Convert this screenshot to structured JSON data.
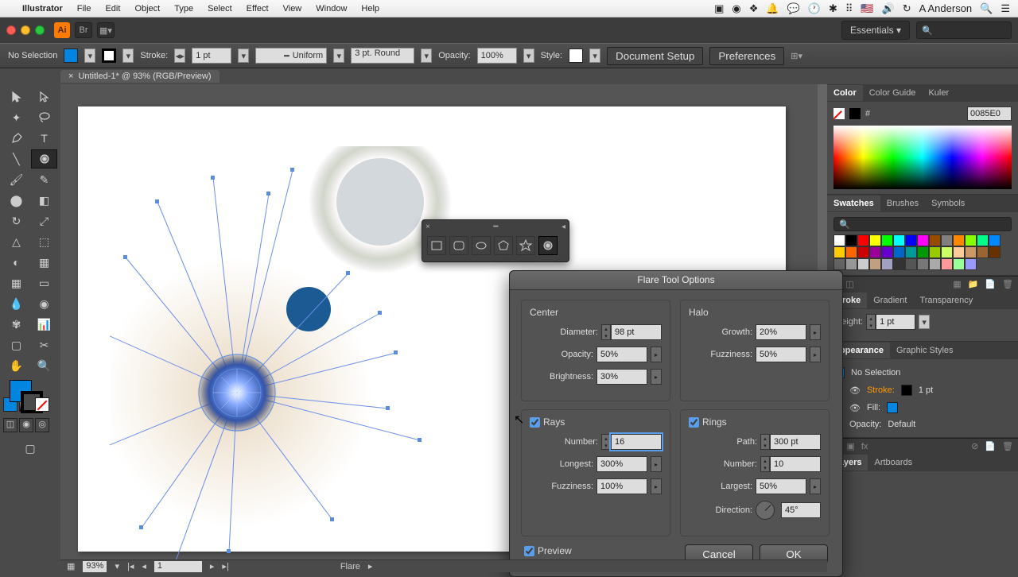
{
  "menubar": {
    "app": "Illustrator",
    "items": [
      "File",
      "Edit",
      "Object",
      "Type",
      "Select",
      "Effect",
      "View",
      "Window",
      "Help"
    ],
    "user": "A Anderson"
  },
  "titlebar": {
    "workspace": "Essentials",
    "search_placeholder": ""
  },
  "controlbar": {
    "selection": "No Selection",
    "stroke_label": "Stroke:",
    "stroke_value": "1 pt",
    "uniform": "Uniform",
    "brush": "3 pt. Round",
    "opacity_label": "Opacity:",
    "opacity_value": "100%",
    "style_label": "Style:",
    "doc_setup": "Document Setup",
    "preferences": "Preferences"
  },
  "document": {
    "tab_title": "Untitled-1* @ 93% (RGB/Preview)"
  },
  "dialog": {
    "title": "Flare Tool Options",
    "center": {
      "legend": "Center",
      "diameter_label": "Diameter:",
      "diameter_value": "98 pt",
      "opacity_label": "Opacity:",
      "opacity_value": "50%",
      "brightness_label": "Brightness:",
      "brightness_value": "30%"
    },
    "halo": {
      "legend": "Halo",
      "growth_label": "Growth:",
      "growth_value": "20%",
      "fuzziness_label": "Fuzziness:",
      "fuzziness_value": "50%"
    },
    "rays": {
      "legend": "Rays",
      "number_label": "Number:",
      "number_value": "16",
      "longest_label": "Longest:",
      "longest_value": "300%",
      "fuzziness_label": "Fuzziness:",
      "fuzziness_value": "100%"
    },
    "rings": {
      "legend": "Rings",
      "path_label": "Path:",
      "path_value": "300 pt",
      "number_label": "Number:",
      "number_value": "10",
      "largest_label": "Largest:",
      "largest_value": "50%",
      "direction_label": "Direction:",
      "direction_value": "45°"
    },
    "preview": "Preview",
    "cancel": "Cancel",
    "ok": "OK"
  },
  "panels": {
    "color": {
      "tab": "Color",
      "tab2": "Color Guide",
      "tab3": "Kuler",
      "hex": "0085E0"
    },
    "swatches": {
      "tab": "Swatches",
      "tab2": "Brushes",
      "tab3": "Symbols",
      "colors": [
        "#fff",
        "#000",
        "#f00",
        "#ff0",
        "#0f0",
        "#0ff",
        "#00f",
        "#f0f",
        "#964B00",
        "#808080",
        "#f80",
        "#8f0",
        "#0f8",
        "#08f",
        "#ffcc00",
        "#ff6600",
        "#cc0000",
        "#990099",
        "#6600cc",
        "#0066cc",
        "#009999",
        "#009900",
        "#99cc00",
        "#ccff66",
        "#ffcc99",
        "#cc9966",
        "#996633",
        "#663300",
        "#666",
        "#999",
        "#ccc",
        "#c0a080",
        "#a0a0c0",
        "#333",
        "#555",
        "#777",
        "#aaa",
        "#f99",
        "#9f9",
        "#99f"
      ]
    },
    "stroke": {
      "tab": "Stroke",
      "tab2": "Gradient",
      "tab3": "Transparency",
      "weight_label": "Weight:",
      "weight_value": "1 pt"
    },
    "appearance": {
      "tab": "Appearance",
      "tab2": "Graphic Styles",
      "title": "No Selection",
      "stroke": "Stroke:",
      "stroke_val": "1 pt",
      "fill": "Fill:",
      "opacity": "Opacity:",
      "opacity_val": "Default"
    },
    "layers": {
      "tab": "Layers",
      "tab2": "Artboards"
    }
  },
  "statusbar": {
    "zoom": "93%",
    "page": "1",
    "tool": "Flare"
  }
}
